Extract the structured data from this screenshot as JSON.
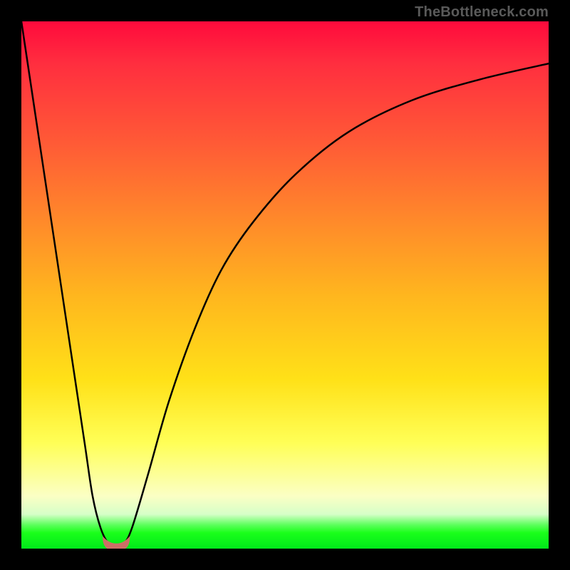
{
  "watermark": "TheBottleneck.com",
  "chart_data": {
    "type": "line",
    "title": "",
    "xlabel": "",
    "ylabel": "",
    "xlim": [
      0,
      100
    ],
    "ylim": [
      0,
      100
    ],
    "grid": false,
    "legend": false,
    "series": [
      {
        "name": "curve",
        "x": [
          0,
          3,
          6,
          9,
          12,
          13.5,
          15,
          16.5,
          18,
          19.5,
          21,
          24,
          28,
          33,
          38,
          44,
          52,
          62,
          74,
          87,
          100
        ],
        "values": [
          100,
          80,
          60,
          40,
          20,
          10,
          4,
          1,
          0.5,
          1,
          4,
          14,
          28,
          42,
          53,
          62,
          71,
          79,
          85,
          89,
          92
        ]
      }
    ],
    "marker": {
      "name": "valley-blob",
      "color": "#cc6f66",
      "x_center": 18,
      "y_center": 0.6,
      "half_width_x": 2.6
    },
    "background_gradient": {
      "top_color": "#ff0a3c",
      "bottom_color": "#00e81a",
      "notes": "vertical red→orange→yellow→green gradient inside plot area"
    }
  }
}
